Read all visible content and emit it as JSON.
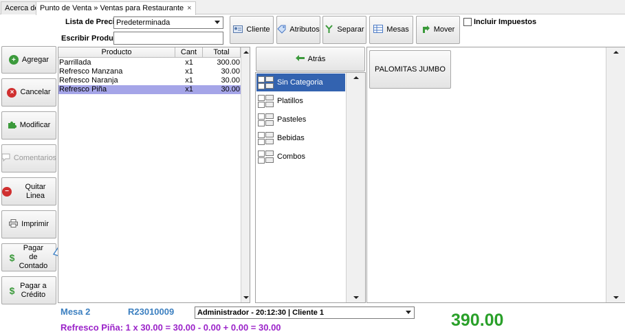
{
  "tabs": [
    {
      "label": "Acerca de"
    },
    {
      "label": "Punto de Venta » Ventas para Restaurante",
      "close": "×"
    }
  ],
  "toolbar": {
    "price_list_label": "Lista de Precios",
    "price_list_value": "Predeterminada",
    "product_label": "Escribir Producto",
    "product_value": "",
    "buttons": {
      "cliente": "Cliente",
      "atributos": "Atributos",
      "separar": "Separar",
      "mesas": "Mesas",
      "mover": "Mover"
    },
    "include_taxes_label": "Incluir Impuestos",
    "include_taxes_checked": false
  },
  "actions": {
    "agregar": "Agregar",
    "cancelar": "Cancelar",
    "modificar": "Modificar",
    "comentarios": "Comentarios",
    "quitar_linea": "Quitar Linea",
    "imprimir": "Imprimir",
    "pagar_contado": "Pagar de Contado",
    "pagar_credito": "Pagar a Crédito"
  },
  "order": {
    "columns": [
      "Producto",
      "Cant",
      "Total"
    ],
    "rows": [
      {
        "product": "Parrillada",
        "qty": "x1",
        "total": "300.00",
        "selected": false
      },
      {
        "product": "Refresco  Manzana",
        "qty": "x1",
        "total": "30.00",
        "selected": false
      },
      {
        "product": "Refresco  Naranja",
        "qty": "x1",
        "total": "30.00",
        "selected": false
      },
      {
        "product": "Refresco Piña",
        "qty": "x1",
        "total": "30.00",
        "selected": true
      }
    ]
  },
  "catalog": {
    "back_label": "Atrás",
    "categories": [
      {
        "label": "Sin Categoria",
        "selected": true
      },
      {
        "label": "Platillos",
        "selected": false
      },
      {
        "label": "Pasteles",
        "selected": false
      },
      {
        "label": "Bebidas",
        "selected": false
      },
      {
        "label": "Combos",
        "selected": false
      }
    ],
    "products": [
      {
        "label": "PALOMITAS JUMBO"
      }
    ]
  },
  "footer": {
    "table": "Mesa 2",
    "ticket": "R23010009",
    "session": "Administrador - 20:12:30 | Cliente 1",
    "line_detail": "Refresco Piña: 1 x 30.00 = 30.00 - 0.00 + 0.00 = 30.00",
    "grand_total": "390.00"
  },
  "colors": {
    "footer_blue": "#3b7fc0",
    "footer_purple": "#9b23c9",
    "total_green": "#2aa02a",
    "selected_category": "#3363b0",
    "selected_row": "#a5a5e8",
    "arrow_blue": "#1f2fa8"
  },
  "icons": {
    "agregar": "plus-circle-icon",
    "cancelar": "x-circle-icon",
    "modificar": "puzzle-icon",
    "comentarios": "speech-bubble-icon",
    "quitar_linea": "minus-circle-icon",
    "imprimir": "printer-icon",
    "pagar": "dollar-icon",
    "cliente": "id-card-icon",
    "atributos": "tag-icon",
    "separar": "split-icon",
    "mesas": "table-icon",
    "mover": "move-arrow-icon",
    "atras": "back-arrow-icon"
  }
}
